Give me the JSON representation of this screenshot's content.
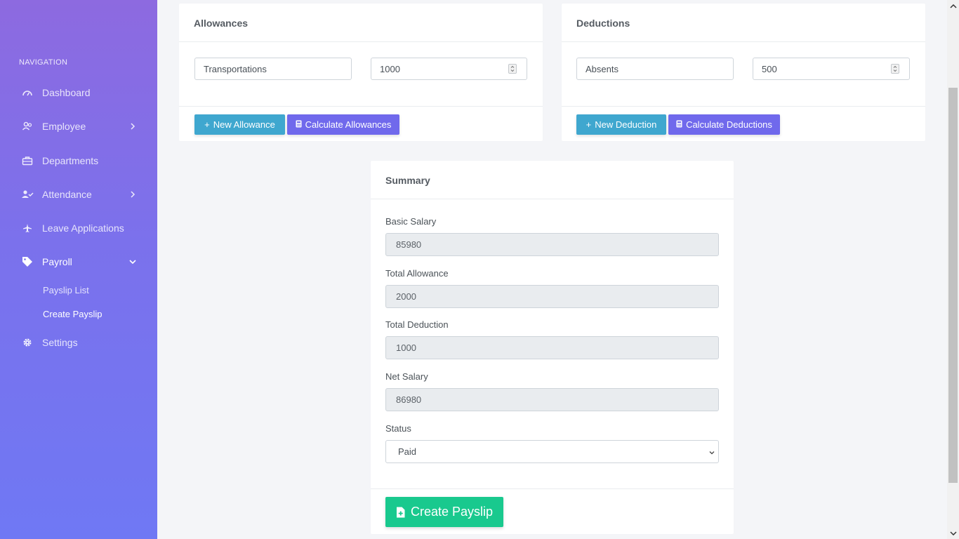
{
  "sidebar": {
    "heading": "NAVIGATION",
    "items": [
      {
        "label": "Dashboard",
        "icon": "dashboard-gauge-icon"
      },
      {
        "label": "Employee",
        "icon": "employee-users-icon"
      },
      {
        "label": "Departments",
        "icon": "briefcase-icon"
      },
      {
        "label": "Attendance",
        "icon": "user-check-icon"
      },
      {
        "label": "Leave Applications",
        "icon": "airplane-icon"
      },
      {
        "label": "Payroll",
        "icon": "tag-icon"
      },
      {
        "label": "Settings",
        "icon": "gear-icon"
      }
    ],
    "payroll_sub": [
      {
        "label": "Payslip List"
      },
      {
        "label": "Create Payslip"
      }
    ]
  },
  "allowances": {
    "title": "Allowances",
    "name_value": "Transportations",
    "amount_value": "1000",
    "new_button": "New Allowance",
    "calc_button": "Calculate Allowances"
  },
  "deductions": {
    "title": "Deductions",
    "name_value": "Absents",
    "amount_value": "500",
    "new_button": "New Deduction",
    "calc_button": "Calculate Deductions"
  },
  "summary": {
    "title": "Summary",
    "basic_salary_label": "Basic Salary",
    "basic_salary": "85980",
    "total_allowance_label": "Total Allowance",
    "total_allowance": "2000",
    "total_deduction_label": "Total Deduction",
    "total_deduction": "1000",
    "net_salary_label": "Net Salary",
    "net_salary": "86980",
    "status_label": "Status",
    "status_value": "Paid",
    "create_button": "Create Payslip"
  },
  "colors": {
    "sidebar_top": "#8d6ae0",
    "sidebar_bottom": "#6f78f4",
    "info_button": "#3fa7cf",
    "primary_button": "#7069ec",
    "success_button": "#19c98e"
  }
}
